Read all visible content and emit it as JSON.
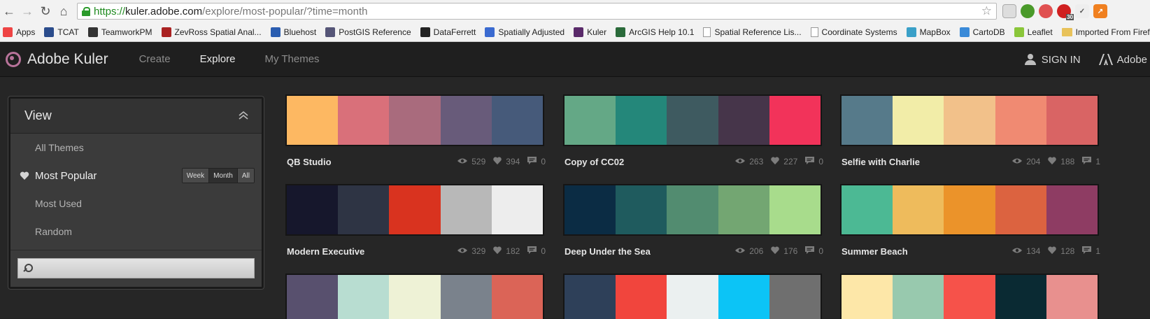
{
  "browser": {
    "url_scheme": "https://",
    "url_host": "kuler.adobe.com",
    "url_path": "/explore/most-popular/?time=month",
    "ext_badge": "30",
    "bookmarks": [
      {
        "label": "Apps",
        "icon": "apps-grid-icon",
        "color": "#e44"
      },
      {
        "label": "TCAT",
        "icon": "tcat-icon",
        "color": "#2b4c8c"
      },
      {
        "label": "TeamworkPM",
        "icon": "teamwork-icon",
        "color": "#333"
      },
      {
        "label": "ZevRoss Spatial Anal...",
        "icon": "zevross-icon",
        "color": "#a22"
      },
      {
        "label": "Bluehost",
        "icon": "bluehost-icon",
        "color": "#2a5db0"
      },
      {
        "label": "PostGIS Reference",
        "icon": "globe-icon",
        "color": "#557"
      },
      {
        "label": "DataFerrett",
        "icon": "df-icon",
        "color": "#222"
      },
      {
        "label": "Spatially Adjusted",
        "icon": "sa-icon",
        "color": "#3a6ad0"
      },
      {
        "label": "Kuler",
        "icon": "kuler-icon",
        "color": "#5a2a6a"
      },
      {
        "label": "ArcGIS Help 10.1",
        "icon": "arcgis-icon",
        "color": "#2a6a3a"
      },
      {
        "label": "Spatial Reference Lis...",
        "icon": "page-icon",
        "color": "#fff"
      },
      {
        "label": "Coordinate Systems",
        "icon": "page-icon",
        "color": "#fff"
      },
      {
        "label": "MapBox",
        "icon": "mapbox-icon",
        "color": "#3aa0c8"
      },
      {
        "label": "CartoDB",
        "icon": "cartodb-icon",
        "color": "#3a8ad8"
      },
      {
        "label": "Leaflet",
        "icon": "leaflet-icon",
        "color": "#8ac63a"
      },
      {
        "label": "Imported From Firef...",
        "icon": "folder-icon",
        "color": "#e8c25a"
      }
    ]
  },
  "header": {
    "app_title": "Adobe Kuler",
    "nav": [
      "Create",
      "Explore",
      "My Themes"
    ],
    "active_nav": "Explore",
    "sign_in": "SIGN IN",
    "adobe": "Adobe"
  },
  "sidebar": {
    "title": "View",
    "items": [
      "All Themes",
      "Most Popular",
      "Most Used",
      "Random"
    ],
    "active_item": "Most Popular",
    "time_filters": [
      "Week",
      "Month",
      "All"
    ],
    "selected_filter": "Month",
    "search_placeholder": ""
  },
  "themes": [
    {
      "name": "QB Studio",
      "views": "529",
      "likes": "394",
      "comments": "0",
      "colors": [
        "#FDB862",
        "#D9707A",
        "#A96B7D",
        "#685B7A",
        "#465A7A"
      ]
    },
    {
      "name": "Copy of CC02",
      "views": "263",
      "likes": "227",
      "comments": "0",
      "colors": [
        "#64A886",
        "#24877A",
        "#3E5A60",
        "#46354A",
        "#F2335A"
      ]
    },
    {
      "name": "Selfie with Charlie",
      "views": "204",
      "likes": "188",
      "comments": "1",
      "colors": [
        "#567A8A",
        "#F2EDA8",
        "#F2C18A",
        "#F08A72",
        "#D96464"
      ]
    },
    {
      "name": "Modern Executive",
      "views": "329",
      "likes": "182",
      "comments": "0",
      "colors": [
        "#16172C",
        "#2E3444",
        "#D9331F",
        "#B8B8B8",
        "#EDEDED"
      ]
    },
    {
      "name": "Deep Under the Sea",
      "views": "206",
      "likes": "176",
      "comments": "0",
      "colors": [
        "#0B2C44",
        "#1F5B5E",
        "#528C70",
        "#73A672",
        "#A8DC8C"
      ]
    },
    {
      "name": "Summer Beach",
      "views": "134",
      "likes": "128",
      "comments": "1",
      "colors": [
        "#4CB994",
        "#EEBB5C",
        "#EB932A",
        "#DC6340",
        "#8E3C63"
      ]
    },
    {
      "name": "",
      "views": "",
      "likes": "",
      "comments": "",
      "colors": [
        "#58506E",
        "#B8DDD1",
        "#EEF2D6",
        "#7A828C",
        "#DB6457"
      ]
    },
    {
      "name": "",
      "views": "",
      "likes": "",
      "comments": "",
      "colors": [
        "#2E4059",
        "#F1453D",
        "#EBF0F0",
        "#0CC4F6",
        "#6F6F6F"
      ]
    },
    {
      "name": "",
      "views": "",
      "likes": "",
      "comments": "",
      "colors": [
        "#FDE7A8",
        "#98C9AE",
        "#F6524A",
        "#0A2A33",
        "#E8908E"
      ]
    }
  ]
}
